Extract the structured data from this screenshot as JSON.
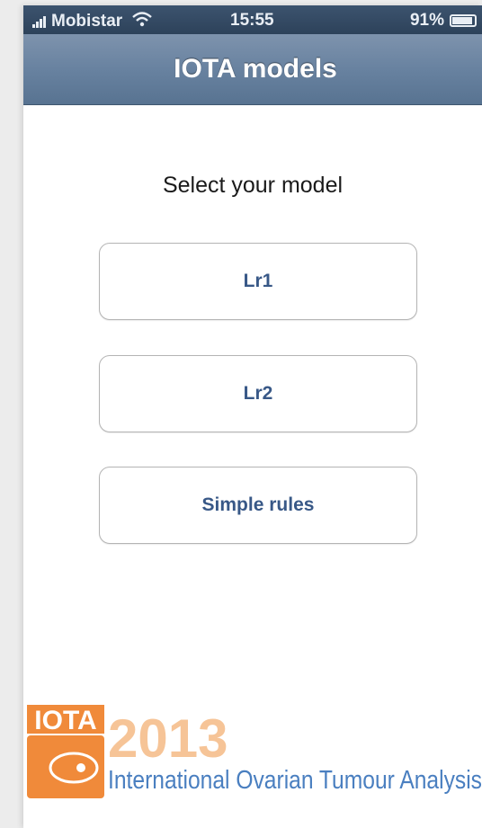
{
  "status_bar": {
    "carrier": "Mobistar",
    "time": "15:55",
    "battery": "91%",
    "icons": [
      "signal-bars-icon",
      "wifi-icon",
      "battery-icon"
    ]
  },
  "nav": {
    "title": "IOTA models"
  },
  "main": {
    "prompt": "Select your model",
    "buttons": [
      {
        "label": "Lr1"
      },
      {
        "label": "Lr2"
      },
      {
        "label": "Simple rules"
      }
    ]
  },
  "logo": {
    "wordmark": "IOTA",
    "year": "2013",
    "tagline": "International Ovarian Tumour Analysis"
  },
  "colors": {
    "nav_bar": "#6882a0",
    "status_bar": "#2d425a",
    "button_text": "#385887",
    "logo_orange": "#f08a3a",
    "logo_year": "#f6c497",
    "logo_tagline": "#4a7fc0"
  }
}
